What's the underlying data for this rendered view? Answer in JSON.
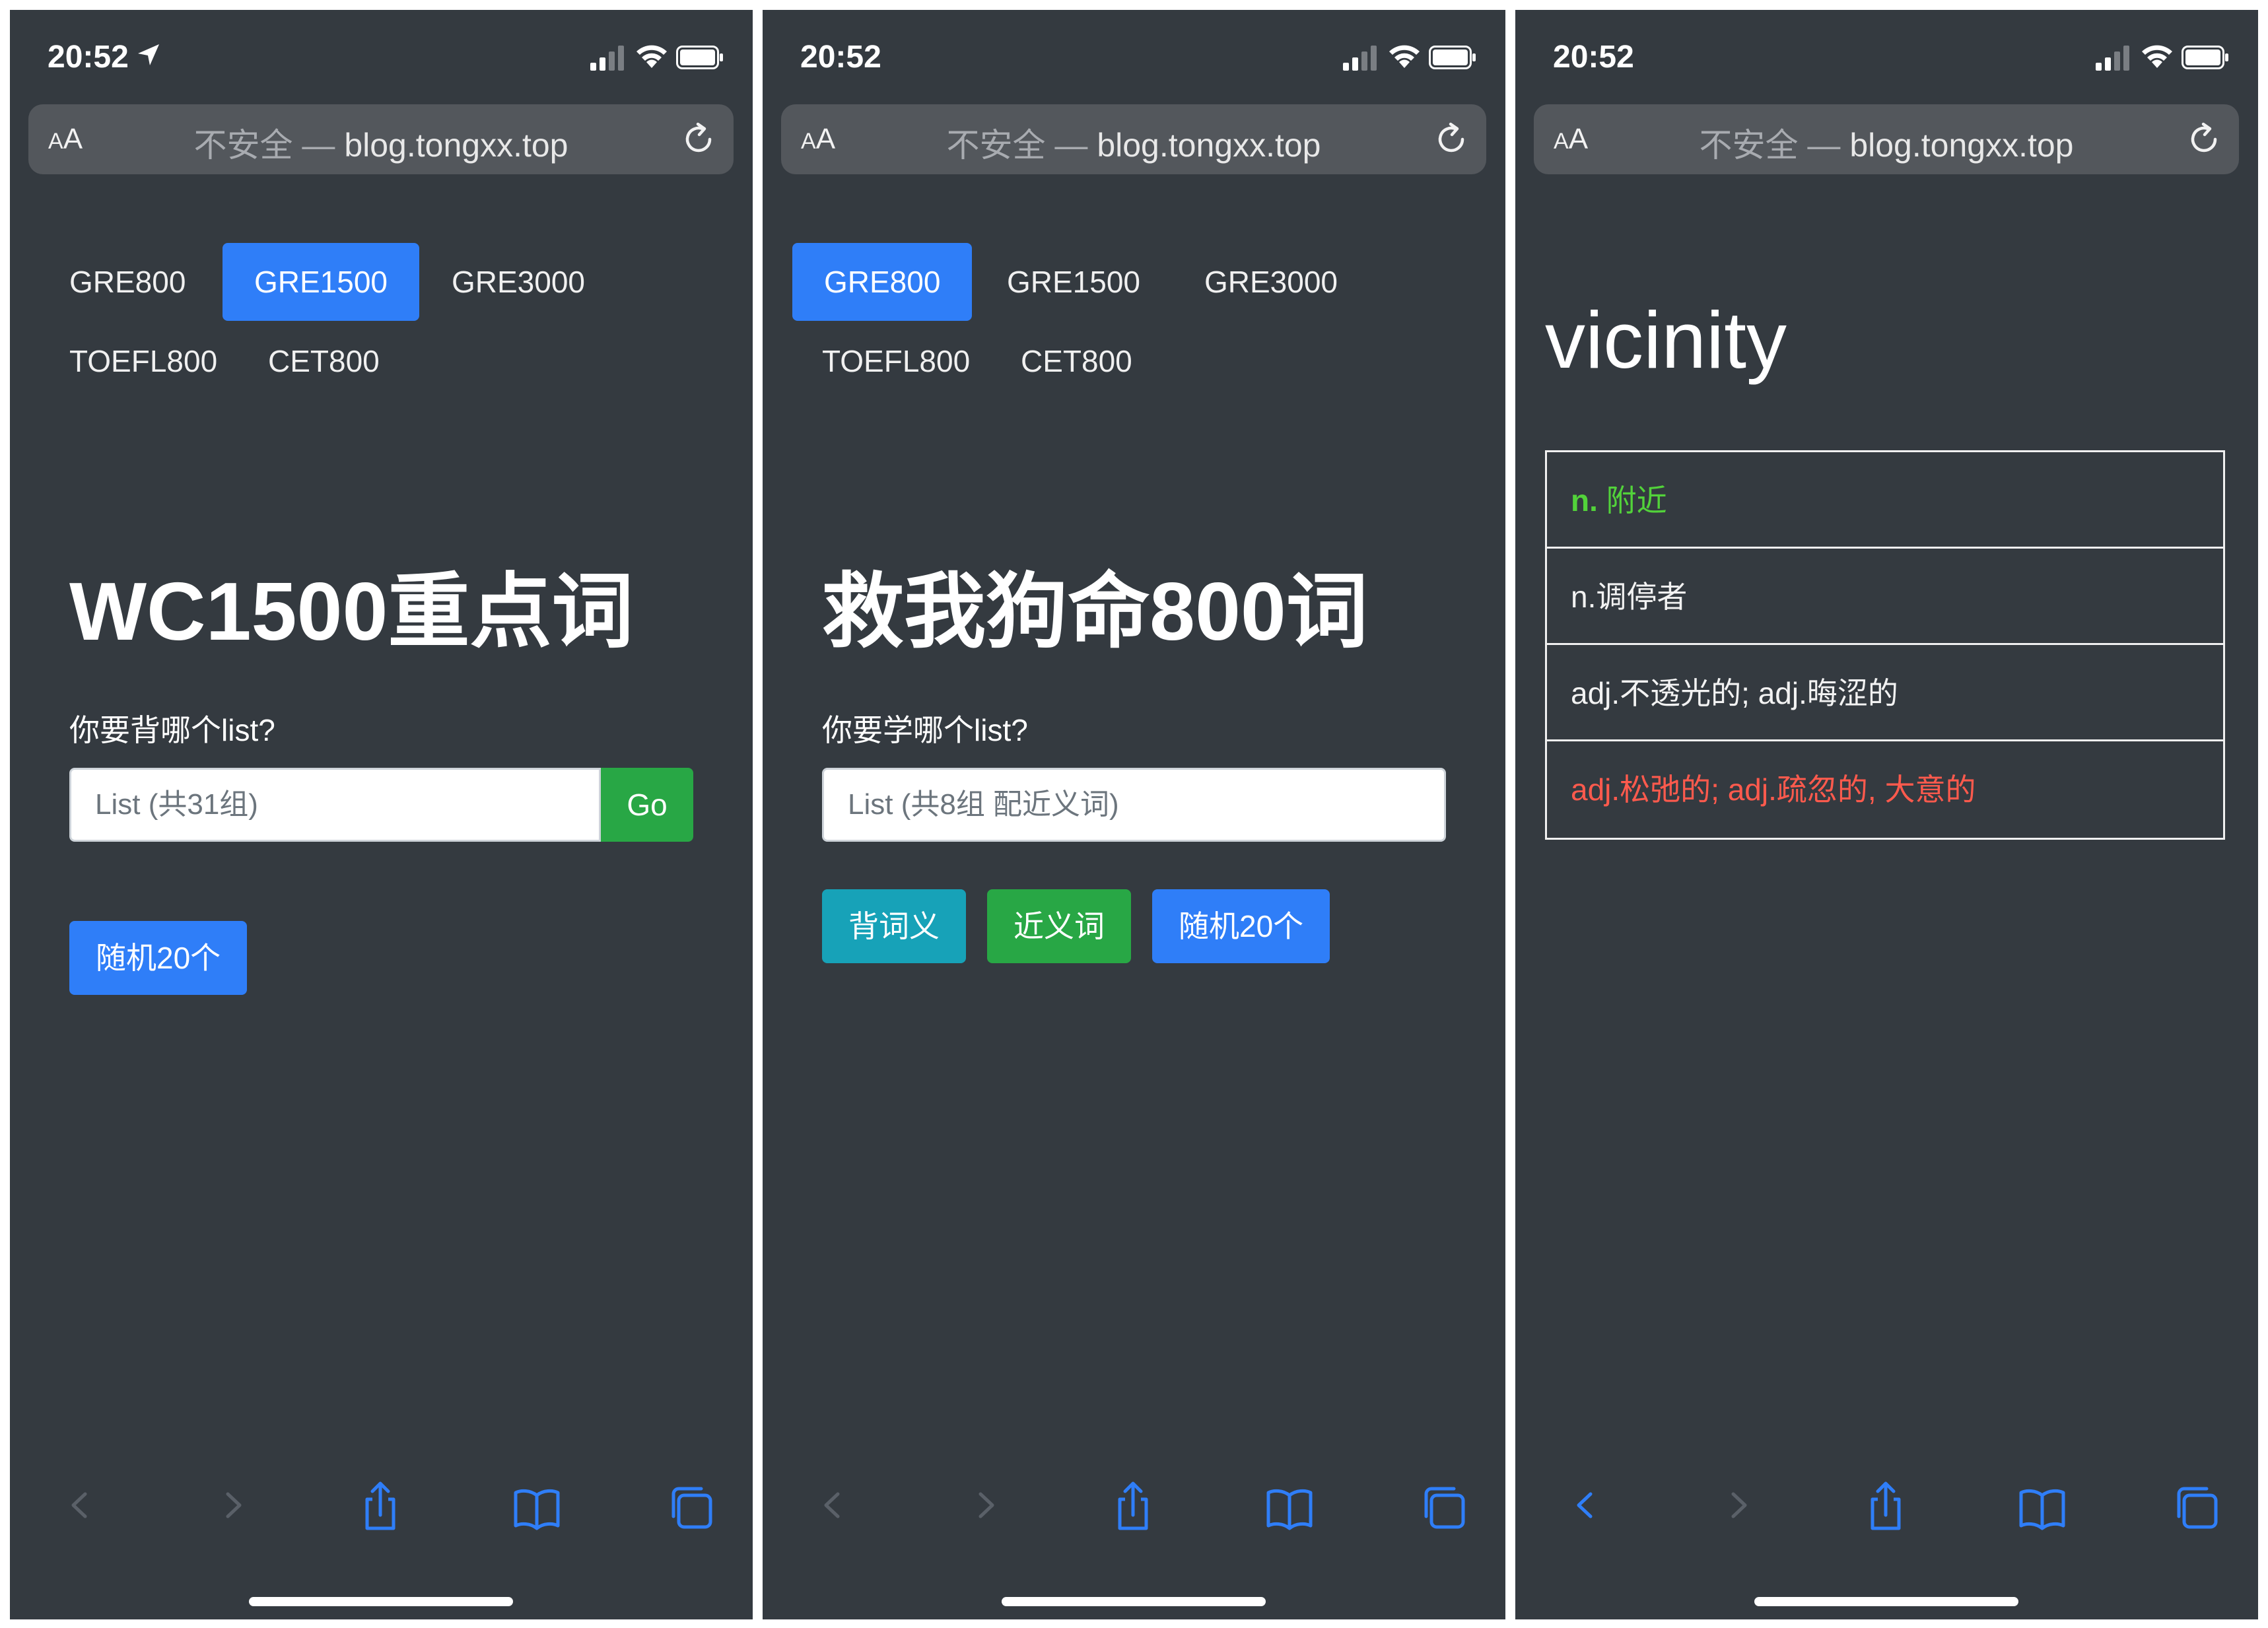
{
  "colors": {
    "panel_bg": "#343a40",
    "primary": "#2f7ef8",
    "success": "#28a745",
    "info": "#17a2b8",
    "correct": "#52d23a",
    "wrong": "#ff5a4d",
    "ios_blue": "#2f7ef8"
  },
  "screens": [
    {
      "status": {
        "time": "20:52",
        "location_icon": "location-arrow-icon"
      },
      "urlbar": {
        "aa_small": "A",
        "aa_big": "A",
        "insecure": "不安全 —",
        "host": "blog.tongxx.top"
      },
      "nav": [
        "GRE800",
        "GRE1500",
        "GRE3000",
        "TOEFL800",
        "CET800"
      ],
      "active_nav": "GRE1500",
      "heading": "WC1500重点词",
      "prompt": "你要背哪个list?",
      "input_placeholder": "List (共31组)",
      "go_label": "Go",
      "buttons": [
        "随机20个"
      ]
    },
    {
      "status": {
        "time": "20:52"
      },
      "urlbar": {
        "aa_small": "A",
        "aa_big": "A",
        "insecure": "不安全 —",
        "host": "blog.tongxx.top"
      },
      "nav": [
        "GRE800",
        "GRE1500",
        "GRE3000",
        "TOEFL800",
        "CET800"
      ],
      "active_nav": "GRE800",
      "heading": "救我狗命800词",
      "prompt": "你要学哪个list?",
      "input_placeholder": "List (共8组 配近义词)",
      "buttons": [
        "背词义",
        "近义词",
        "随机20个"
      ]
    },
    {
      "status": {
        "time": "20:52"
      },
      "urlbar": {
        "aa_small": "A",
        "aa_big": "A",
        "insecure": "不安全 —",
        "host": "blog.tongxx.top"
      },
      "word": "vicinity",
      "meanings": [
        {
          "pos": "n.",
          "text": " 附近",
          "state": "correct"
        },
        {
          "pos": "",
          "text": "n.调停者",
          "state": "neutral"
        },
        {
          "pos": "",
          "text": "adj.不透光的; adj.晦涩的",
          "state": "neutral"
        },
        {
          "pos": "",
          "text": "adj.松弛的; adj.疏忽的, 大意的",
          "state": "wrong"
        }
      ]
    }
  ],
  "toolbar": [
    "back-icon",
    "forward-icon",
    "share-icon",
    "bookmarks-icon",
    "tabs-icon"
  ]
}
